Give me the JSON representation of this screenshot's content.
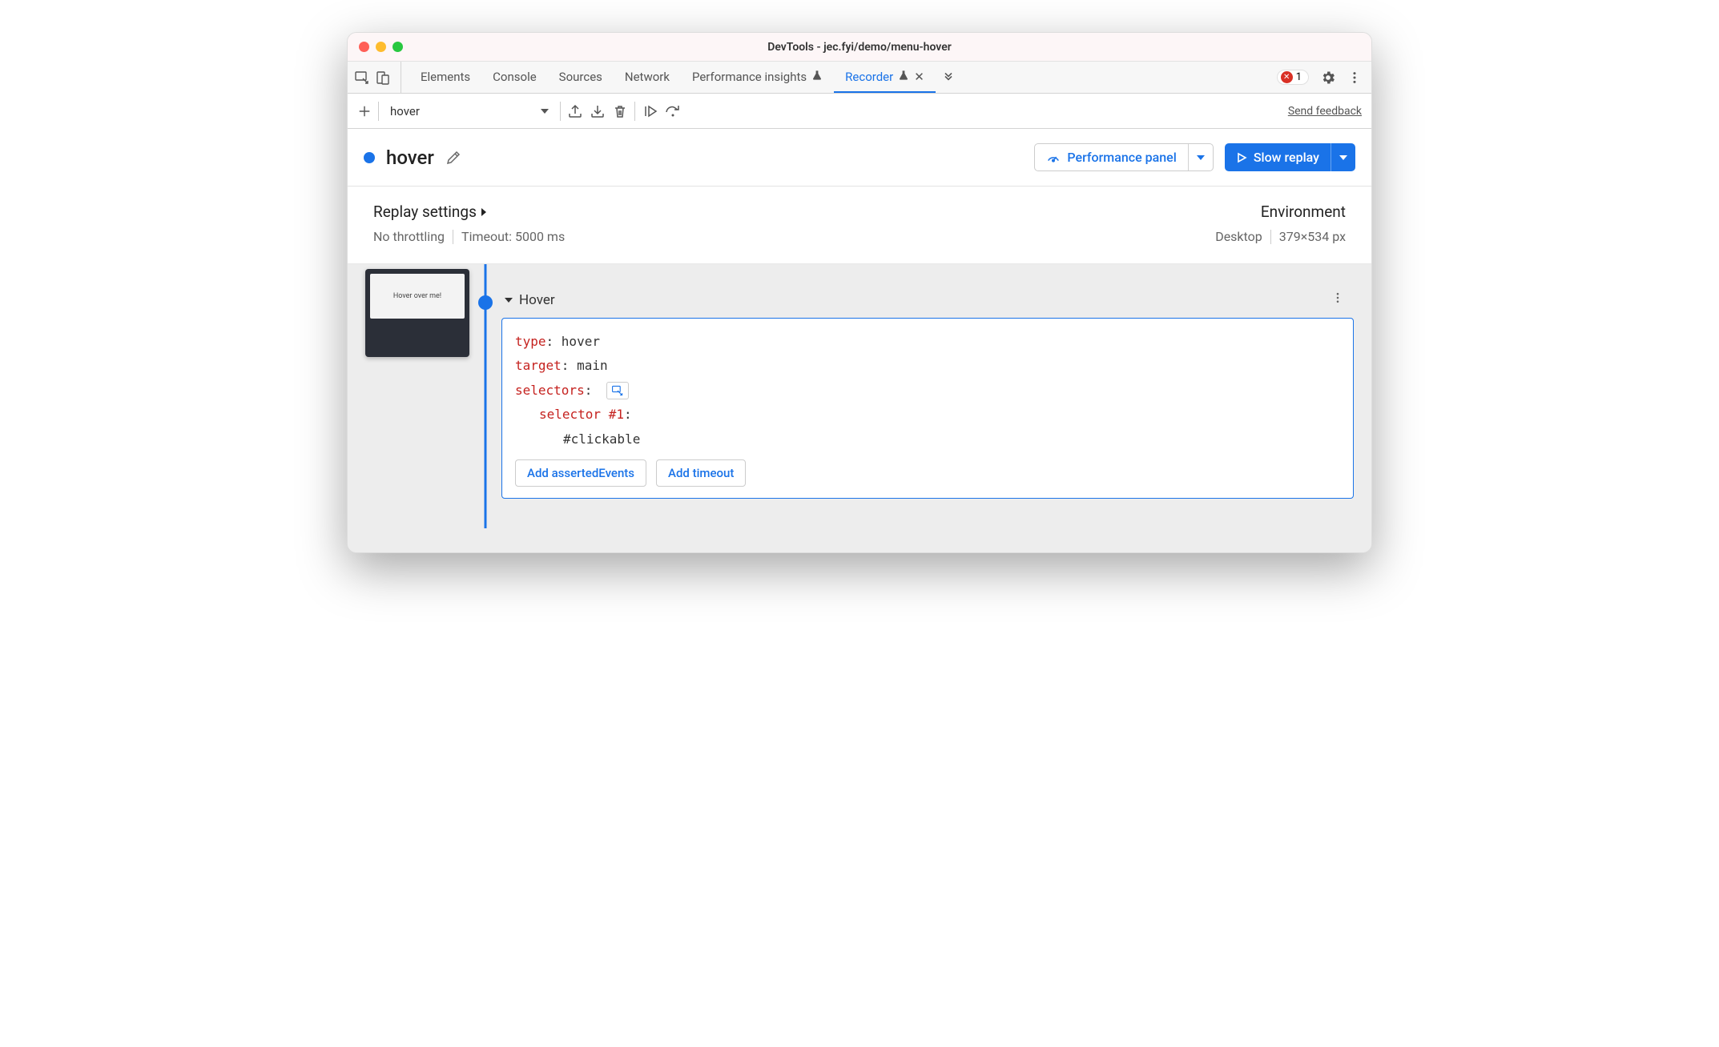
{
  "window": {
    "title": "DevTools - jec.fyi/demo/menu-hover"
  },
  "tabs": {
    "items": [
      {
        "label": "Elements",
        "active": false
      },
      {
        "label": "Console",
        "active": false
      },
      {
        "label": "Sources",
        "active": false
      },
      {
        "label": "Network",
        "active": false
      },
      {
        "label": "Performance insights",
        "active": false,
        "experiment": true
      },
      {
        "label": "Recorder",
        "active": true,
        "experiment": true,
        "closeable": true
      }
    ],
    "error_count": "1"
  },
  "toolbar": {
    "recording_name": "hover",
    "feedback_link": "Send feedback"
  },
  "recorder_header": {
    "title": "hover",
    "performance_button": "Performance panel",
    "replay_button": "Slow replay"
  },
  "settings": {
    "replay_title": "Replay settings",
    "throttling": "No throttling",
    "timeout": "Timeout: 5000 ms",
    "env_title": "Environment",
    "device": "Desktop",
    "dimensions": "379×534 px"
  },
  "thumbnail": {
    "text": "Hover over me!"
  },
  "step": {
    "title": "Hover",
    "type_key": "type",
    "type_value": "hover",
    "target_key": "target",
    "target_value": "main",
    "selectors_key": "selectors",
    "selector_label": "selector #1",
    "selector_value": "#clickable",
    "add_asserted": "Add assertedEvents",
    "add_timeout": "Add timeout"
  }
}
